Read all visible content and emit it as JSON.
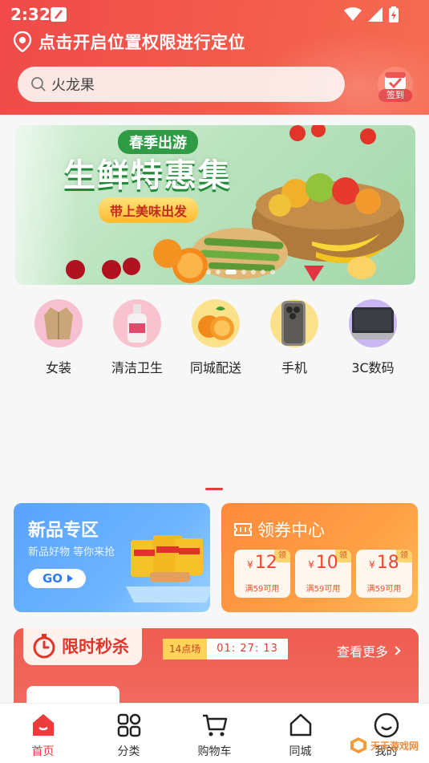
{
  "status_bar": {
    "time": "2:32"
  },
  "header": {
    "location_text": "点击开启位置权限进行定位",
    "search_placeholder": "火龙果",
    "checkin_label": "签到"
  },
  "banner": {
    "top_text": "春季出游",
    "main_text": "生鲜特惠集",
    "button_text": "带上美味出发"
  },
  "categories": [
    {
      "label": "女装",
      "icon": "coat-icon"
    },
    {
      "label": "清洁卫生",
      "icon": "bodywash-icon"
    },
    {
      "label": "同城配送",
      "icon": "orange-icon"
    },
    {
      "label": "手机",
      "icon": "phone-icon"
    },
    {
      "label": "3C数码",
      "icon": "laptop-icon"
    }
  ],
  "promo_new": {
    "title": "新品专区",
    "subtitle": "新品好物 等你来抢",
    "go_label": "GO"
  },
  "promo_coupon": {
    "title": "领券中心",
    "coupons": [
      {
        "currency": "¥",
        "amount": "12",
        "tag": "领",
        "condition": "满59可用"
      },
      {
        "currency": "¥",
        "amount": "10",
        "tag": "领",
        "condition": "满59可用"
      },
      {
        "currency": "¥",
        "amount": "18",
        "tag": "领",
        "condition": "满59可用"
      }
    ]
  },
  "flash_sale": {
    "title": "限时秒杀",
    "session": "14点场",
    "countdown": "01: 27: 13",
    "more": "查看更多"
  },
  "bottom_nav": [
    {
      "label": "首页",
      "active": true
    },
    {
      "label": "分类",
      "active": false
    },
    {
      "label": "购物车",
      "active": false
    },
    {
      "label": "同城",
      "active": false
    },
    {
      "label": "我的",
      "active": false
    }
  ],
  "watermark": {
    "text": "天天游戏网"
  },
  "colors": {
    "accent": "#ec3b3b",
    "header": "#f04a4a",
    "new_card": "#5aa3ff",
    "coupon_card": "#ff8a3c"
  }
}
